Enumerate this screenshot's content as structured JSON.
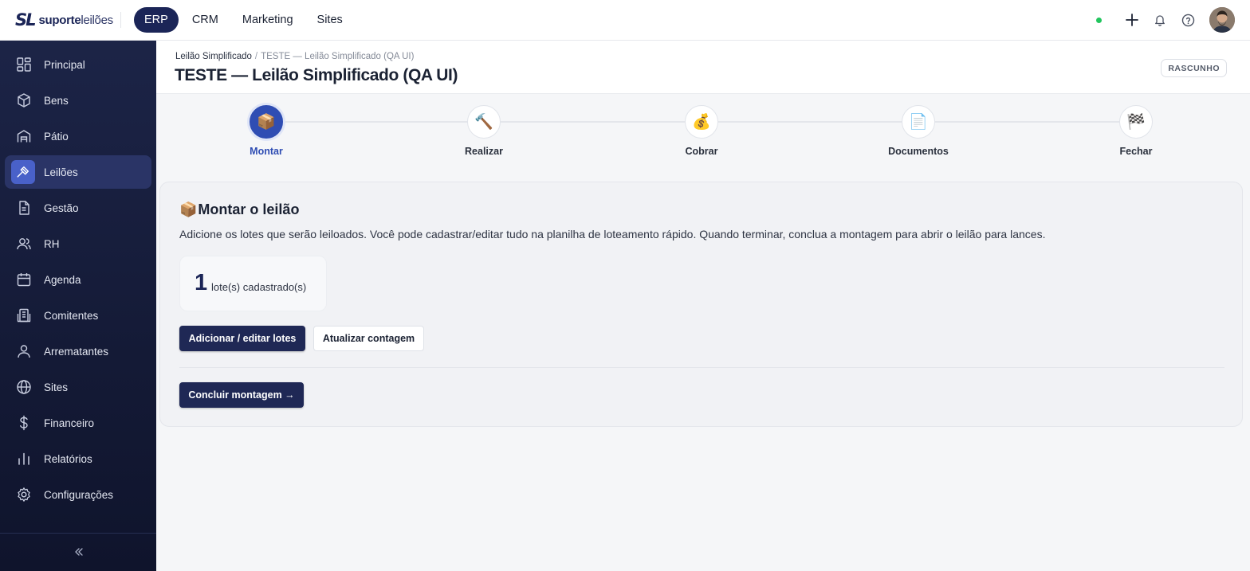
{
  "brand": {
    "mark": "SL",
    "name_bold": "suporte",
    "name_light": "leilões"
  },
  "topnav": {
    "items": [
      {
        "label": "ERP",
        "active": true
      },
      {
        "label": "CRM"
      },
      {
        "label": "Marketing"
      },
      {
        "label": "Sites"
      }
    ]
  },
  "topbar_icons": [
    "status-dot",
    "plus-icon",
    "bell-icon",
    "help-icon",
    "avatar"
  ],
  "sidebar": {
    "items": [
      {
        "label": "Principal",
        "icon": "grid-icon"
      },
      {
        "label": "Bens",
        "icon": "box-icon"
      },
      {
        "label": "Pátio",
        "icon": "warehouse-icon"
      },
      {
        "label": "Leilões",
        "icon": "gavel-icon",
        "active": true
      },
      {
        "label": "Gestão",
        "icon": "document-icon"
      },
      {
        "label": "RH",
        "icon": "users-icon"
      },
      {
        "label": "Agenda",
        "icon": "calendar-icon"
      },
      {
        "label": "Comitentes",
        "icon": "building-icon"
      },
      {
        "label": "Arrematantes",
        "icon": "user-icon"
      },
      {
        "label": "Sites",
        "icon": "globe-icon"
      },
      {
        "label": "Financeiro",
        "icon": "dollar-icon"
      },
      {
        "label": "Relatórios",
        "icon": "bar-chart-icon"
      },
      {
        "label": "Configurações",
        "icon": "gear-icon"
      }
    ]
  },
  "breadcrumb": {
    "parent": "Leilão Simplificado",
    "separator": "/",
    "current": "TESTE — Leilão Simplificado (QA UI)"
  },
  "page_title": "TESTE — Leilão Simplificado (QA UI)",
  "status_badge": "RASCUNHO",
  "stepper": {
    "steps": [
      {
        "label": "Montar",
        "emoji": "📦",
        "active": true
      },
      {
        "label": "Realizar",
        "emoji": "🔨"
      },
      {
        "label": "Cobrar",
        "emoji": "💰"
      },
      {
        "label": "Documentos",
        "emoji": "📄"
      },
      {
        "label": "Fechar",
        "emoji": "🏁"
      }
    ]
  },
  "card": {
    "emoji": "📦",
    "title": "Montar o leilão",
    "description": "Adicione os lotes que serão leiloados. Você pode cadastrar/editar tudo na planilha de loteamento rápido. Quando terminar, conclua a montagem para abrir o leilão para lances.",
    "count": "1",
    "count_label": "lote(s) cadastrado(s)",
    "btn_edit": "Adicionar / editar lotes",
    "btn_refresh": "Atualizar contagem",
    "btn_conclude": "Concluir montagem →"
  },
  "colors": {
    "brand_navy": "#1b2557",
    "accent_blue": "#2f4db3",
    "sidebar_bg": "#1c2447",
    "status_green": "#22c55e"
  }
}
